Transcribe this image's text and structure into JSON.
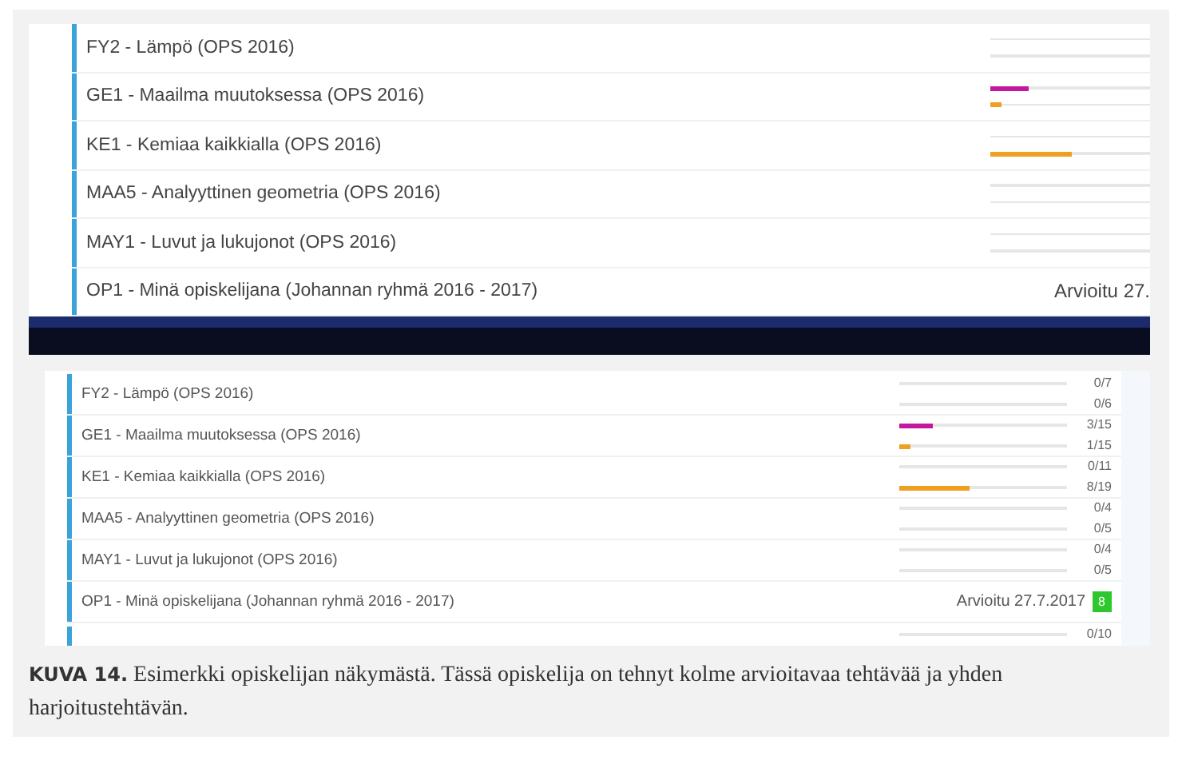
{
  "top_view": {
    "rows": [
      {
        "title": "FY2 - Lämpö (OPS 2016)",
        "bars": [
          {
            "kind": "empty"
          },
          {
            "kind": "empty"
          }
        ]
      },
      {
        "title": "GE1 - Maailma muutoksessa (OPS 2016)",
        "bars": [
          {
            "kind": "filled",
            "level": 0.24,
            "color": "#c2189e"
          },
          {
            "kind": "filled",
            "level": 0.07,
            "color": "#f0a020"
          }
        ]
      },
      {
        "title": "KE1 - Kemiaa kaikkialla (OPS 2016)",
        "bars": [
          {
            "kind": "empty"
          },
          {
            "kind": "filled",
            "level": 0.51,
            "color": "#f0a020"
          }
        ]
      },
      {
        "title": "MAA5 - Analyyttinen geometria (OPS 2016)",
        "bars": [
          {
            "kind": "empty"
          },
          {
            "kind": "empty"
          }
        ]
      },
      {
        "title": "MAY1 - Luvut ja lukujonot (OPS 2016)",
        "bars": [
          {
            "kind": "empty"
          },
          {
            "kind": "empty"
          }
        ]
      },
      {
        "title": "OP1 - Minä opiskelijana (Johannan ryhmä 2016 - 2017)",
        "status": "Arvioitu 27."
      }
    ]
  },
  "bottom_view": {
    "rows": [
      {
        "title": "FY2 - Lämpö (OPS 2016)",
        "bars": [
          {
            "kind": "empty",
            "count": "0/7"
          },
          {
            "kind": "empty",
            "count": "0/6"
          }
        ]
      },
      {
        "title": "GE1 - Maailma muutoksessa (OPS 2016)",
        "bars": [
          {
            "kind": "filled",
            "level": 0.2,
            "color": "#c2189e",
            "count": "3/15"
          },
          {
            "kind": "filled",
            "level": 0.067,
            "color": "#f0a020",
            "count": "1/15"
          }
        ]
      },
      {
        "title": "KE1 - Kemiaa kaikkialla (OPS 2016)",
        "bars": [
          {
            "kind": "empty",
            "count": "0/11"
          },
          {
            "kind": "filled",
            "level": 0.42,
            "color": "#f0a020",
            "count": "8/19"
          }
        ]
      },
      {
        "title": "MAA5 - Analyyttinen geometria (OPS 2016)",
        "bars": [
          {
            "kind": "empty",
            "count": "0/4"
          },
          {
            "kind": "empty",
            "count": "0/5"
          }
        ]
      },
      {
        "title": "MAY1 - Luvut ja lukujonot (OPS 2016)",
        "bars": [
          {
            "kind": "empty",
            "count": "0/4"
          },
          {
            "kind": "empty",
            "count": "0/5"
          }
        ]
      },
      {
        "title": "OP1 - Minä opiskelijana (Johannan ryhmä 2016 - 2017)",
        "status": "Arvioitu 27.7.2017",
        "grade": "8"
      },
      {
        "bars": [
          {
            "kind": "empty",
            "count": "0/10"
          }
        ]
      }
    ]
  },
  "caption": "**KUVA 14.** Esimerkki opiskelijan näkymästä. Tässä opiskelija on tehnyt kolme arvioitavaa tehtävää ja yhden harjoitustehtävän."
}
